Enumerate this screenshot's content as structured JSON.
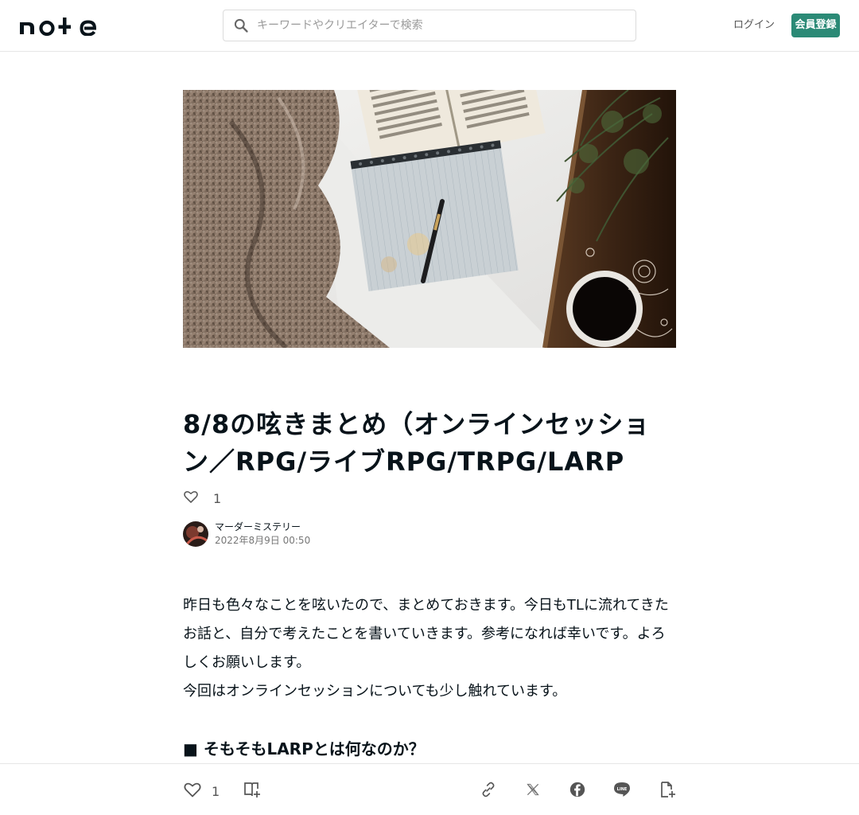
{
  "header": {
    "logo_text": "note",
    "search": {
      "placeholder": "キーワードやクリエイターで検索"
    },
    "login_label": "ログイン",
    "signup_label": "会員登録"
  },
  "colors": {
    "accent": "#2b8a76",
    "text": "#08131a",
    "muted": "#777777"
  },
  "article": {
    "title": "8/8の呟きまとめ（オンラインセッション／RPG/ライブRPG/TRPG/LARP",
    "like_count": "1",
    "author_name": "マーダーミステリー",
    "post_date": "2022年8月9日 00:50",
    "paragraphs": [
      "昨日も色々なことを呟いたので、まとめておきます。今日もTLに流れてきたお話と、自分で考えたことを書いていきます。参考になれば幸いです。よろしくお願いします。",
      "今回はオンラインセッションについても少し触れています。"
    ],
    "section_heading": "■ そもそもLARPとは何なのか？"
  },
  "bottom_bar": {
    "like_count": "1",
    "icons": [
      "heart-icon",
      "magazine-add-icon",
      "link-icon",
      "x-icon",
      "facebook-icon",
      "line-icon",
      "note-add-icon"
    ]
  }
}
